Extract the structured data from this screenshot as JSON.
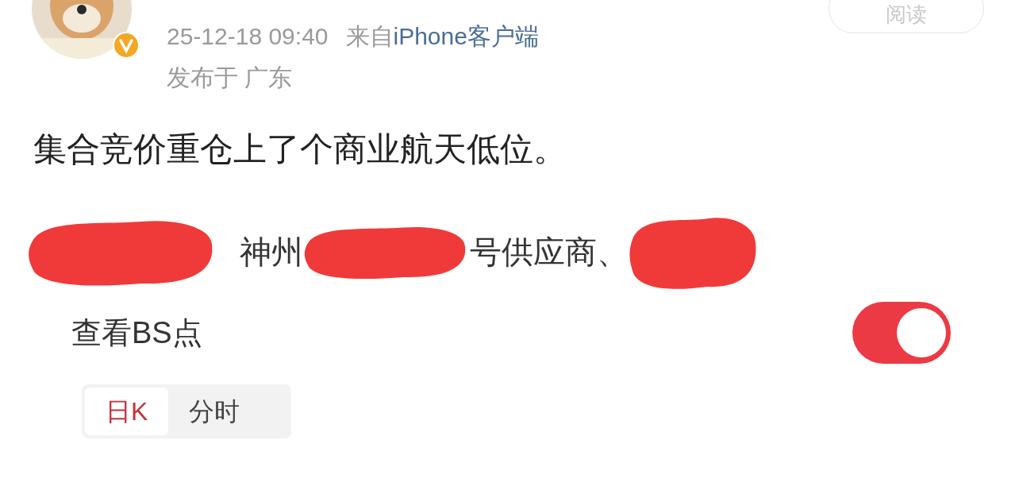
{
  "header": {
    "read_button": "阅读",
    "time": "25-12-18 09:40",
    "source_prefix": "来自",
    "source": "iPhone客户端",
    "location": "发布于 广东",
    "verified": true
  },
  "post": {
    "text": "集合竞价重仓上了个商业航天低位。",
    "line2_segments": [
      "神州",
      "号供应商、"
    ]
  },
  "embedded": {
    "setting_label": "查看BS点",
    "toggle_on": true,
    "tabs": [
      {
        "label": "日K",
        "selected": true
      },
      {
        "label": "分时",
        "selected": false
      }
    ]
  }
}
